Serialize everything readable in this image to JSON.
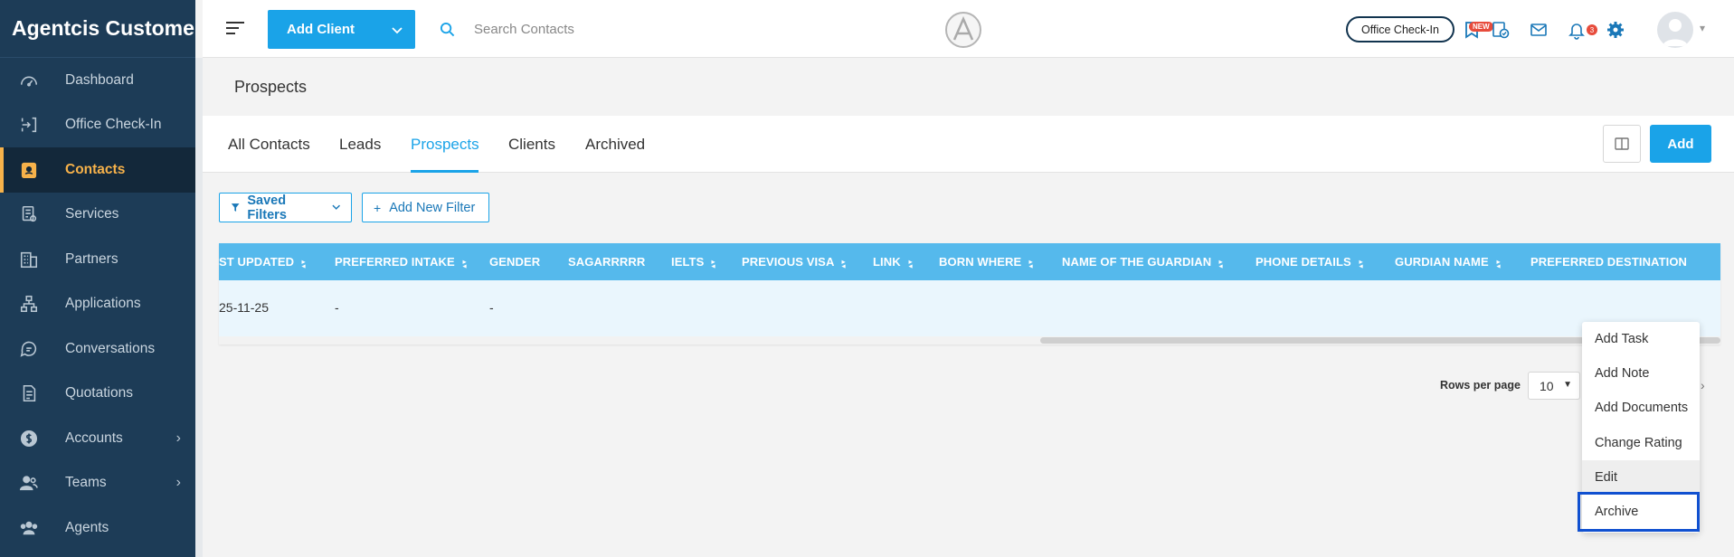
{
  "sidebar": {
    "brand": "Agentcis Custome...",
    "items": [
      {
        "label": "Dashboard",
        "icon": "gauge-icon"
      },
      {
        "label": "Office Check-In",
        "icon": "checkin-icon"
      },
      {
        "label": "Contacts",
        "icon": "contact-card-icon",
        "active": true
      },
      {
        "label": "Services",
        "icon": "services-icon"
      },
      {
        "label": "Partners",
        "icon": "building-icon"
      },
      {
        "label": "Applications",
        "icon": "workflow-icon"
      },
      {
        "label": "Conversations",
        "icon": "chat-icon"
      },
      {
        "label": "Quotations",
        "icon": "document-icon"
      },
      {
        "label": "Accounts",
        "icon": "dollar-icon",
        "has_children": true
      },
      {
        "label": "Teams",
        "icon": "team-icon",
        "has_children": true
      },
      {
        "label": "Agents",
        "icon": "agents-icon"
      }
    ]
  },
  "topbar": {
    "add_client_label": "Add Client",
    "search_placeholder": "Search Contacts",
    "office_checkin_label": "Office Check-In",
    "new_badge": "NEW",
    "notification_count": "3"
  },
  "page": {
    "title": "Prospects"
  },
  "tabs": [
    {
      "label": "All Contacts"
    },
    {
      "label": "Leads"
    },
    {
      "label": "Prospects",
      "active": true
    },
    {
      "label": "Clients"
    },
    {
      "label": "Archived"
    }
  ],
  "actions": {
    "add_label": "Add"
  },
  "filters": {
    "saved_label": "Saved Filters",
    "new_label": "Add New Filter"
  },
  "table": {
    "columns": [
      "ST UPDATED",
      "PREFERRED INTAKE",
      "GENDER",
      "SAGARRRRR",
      "IELTS",
      "PREVIOUS VISA",
      "LINK",
      "BORN WHERE",
      "NAME OF THE GUARDIAN",
      "PHONE DETAILS",
      "GURDIAN NAME",
      "PREFERRED DESTINATION"
    ],
    "sortable": [
      true,
      true,
      false,
      false,
      true,
      true,
      true,
      true,
      true,
      true,
      true,
      false
    ],
    "rows": [
      [
        "25-11-25",
        "-",
        "-",
        "",
        "",
        "",
        "",
        "",
        "",
        "",
        "",
        ""
      ]
    ]
  },
  "pagination": {
    "rows_per_page_label": "Rows per page",
    "rows_per_page_value": "10"
  },
  "context_menu": {
    "items": [
      "Add Task",
      "Add Note",
      "Add Documents",
      "Change Rating",
      "Edit",
      "Archive"
    ],
    "hovered": "Edit",
    "focused": "Archive"
  },
  "colors": {
    "sidebar_bg": "#1d3c57",
    "accent": "#1aa3e8",
    "active_nav": "#f7b24a",
    "table_header": "#55b9ec"
  }
}
